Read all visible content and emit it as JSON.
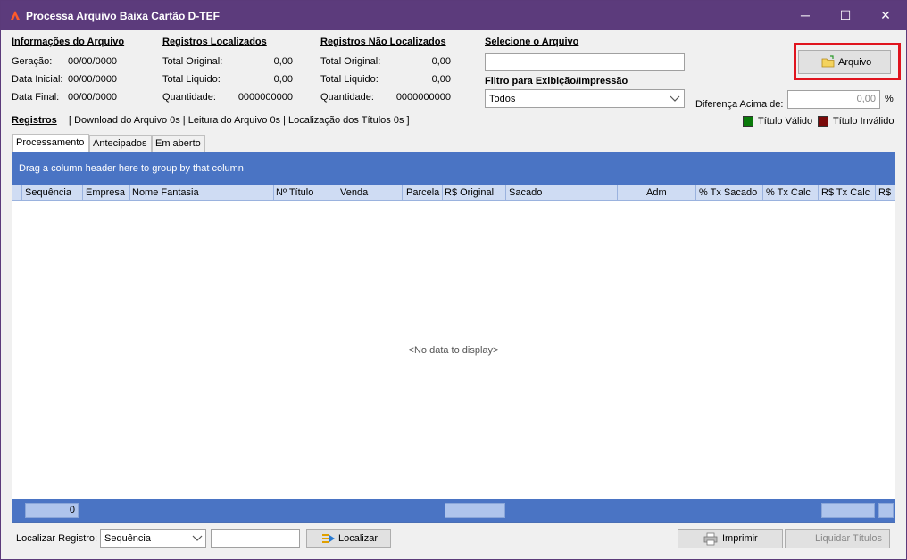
{
  "window": {
    "title": "Processa Arquivo Baixa Cartão D-TEF",
    "minimize": "─",
    "maximize": "☐",
    "close": "✕"
  },
  "info": {
    "header": "Informações do Arquivo",
    "geracao_label": "Geração:",
    "geracao_value": "00/00/0000",
    "data_inicial_label": "Data Inicial:",
    "data_inicial_value": "00/00/0000",
    "data_final_label": "Data Final:",
    "data_final_value": "00/00/0000"
  },
  "localizados": {
    "header": "Registros Localizados",
    "total_original_label": "Total Original:",
    "total_original_value": "0,00",
    "total_liquido_label": "Total Liquido:",
    "total_liquido_value": "0,00",
    "quantidade_label": "Quantidade:",
    "quantidade_value": "0000000000"
  },
  "nao_localizados": {
    "header": "Registros Não Localizados",
    "total_original_label": "Total Original:",
    "total_original_value": "0,00",
    "total_liquido_label": "Total Liquido:",
    "total_liquido_value": "0,00",
    "quantidade_label": "Quantidade:",
    "quantidade_value": "0000000000"
  },
  "arquivo": {
    "header": "Selecione o Arquivo",
    "path_value": "",
    "button_label": "Arquivo"
  },
  "filtro": {
    "header": "Filtro para Exibição/Impressão",
    "selected": "Todos"
  },
  "diferenca": {
    "label": "Diferença Acima de:",
    "value": "0,00",
    "unit": "%"
  },
  "registros": {
    "label": "Registros",
    "timing": "[ Download do Arquivo 0s | Leitura do Arquivo 0s | Localização dos Títulos 0s ]"
  },
  "legend": {
    "valid_label": "Título Válido",
    "valid_color": "#0a7a0a",
    "invalid_label": "Título Inválido",
    "invalid_color": "#7a0a0a"
  },
  "tabs": [
    "Processamento",
    "Antecipados",
    "Em aberto"
  ],
  "grid": {
    "group_hint": "Drag a column header here to group by that column",
    "columns": [
      "Sequência",
      "Empresa",
      "Nome Fantasia",
      "Nº Título",
      "Venda",
      "Parcela",
      "R$ Original",
      "Sacado",
      "Adm",
      "% Tx Sacado",
      "% Tx Calc",
      "R$ Tx Calc",
      "R$ I"
    ],
    "no_data": "<No data to display>",
    "footer_count": "0"
  },
  "bottom": {
    "localizar_label": "Localizar Registro:",
    "localizar_field": "Sequência",
    "localizar_value": "",
    "localizar_button": "Localizar",
    "imprimir_button": "Imprimir",
    "liquidar_button": "Liquidar Títulos"
  }
}
